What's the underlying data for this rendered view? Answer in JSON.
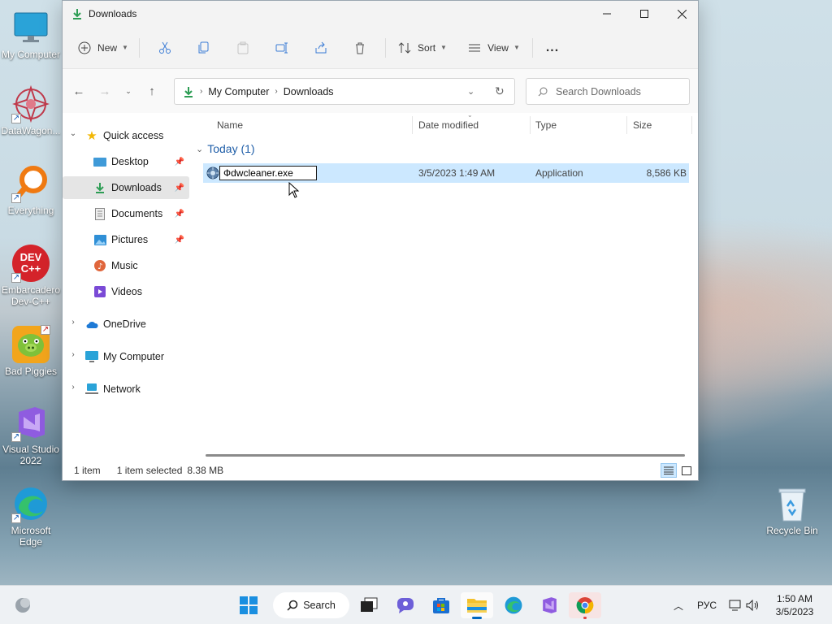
{
  "desktop": {
    "icons": [
      {
        "label": "My Computer"
      },
      {
        "label": "DataWagon..."
      },
      {
        "label": "Everything"
      },
      {
        "label": "Embarcadero Dev-C++"
      },
      {
        "label": "Bad Piggies"
      },
      {
        "label": "Visual Studio 2022"
      },
      {
        "label": "Microsoft Edge"
      },
      {
        "label": "Recycle Bin"
      }
    ],
    "devcpp_logo_text": "DEV C++"
  },
  "window": {
    "title": "Downloads",
    "toolbar": {
      "new_label": "New",
      "sort_label": "Sort",
      "view_label": "View",
      "more_label": "..."
    },
    "address": {
      "crumbs": [
        "My Computer",
        "Downloads"
      ]
    },
    "search": {
      "placeholder": "Search Downloads"
    },
    "nav": {
      "quick_access": "Quick access",
      "items": [
        {
          "label": "Desktop",
          "pinned": true
        },
        {
          "label": "Downloads",
          "pinned": true,
          "selected": true
        },
        {
          "label": "Documents",
          "pinned": true
        },
        {
          "label": "Pictures",
          "pinned": true
        },
        {
          "label": "Music",
          "pinned": false
        },
        {
          "label": "Videos",
          "pinned": false
        }
      ],
      "onedrive": "OneDrive",
      "my_computer": "My Computer",
      "network": "Network"
    },
    "columns": {
      "name": "Name",
      "date_modified": "Date modified",
      "type": "Type",
      "size": "Size"
    },
    "group": {
      "label": "Today (1)"
    },
    "files": [
      {
        "name": "Фdwcleaner.exe",
        "date_modified": "3/5/2023 1:49 AM",
        "type": "Application",
        "size": "8,586 KB",
        "selected": true,
        "renaming": true
      }
    ],
    "status": {
      "count": "1 item",
      "selection": "1 item selected",
      "selection_size": "8.38 MB"
    }
  },
  "taskbar": {
    "search_label": "Search",
    "language": "РУС",
    "time": "1:50 AM",
    "date": "3/5/2023"
  },
  "colors": {
    "accent": "#0067c0",
    "selection": "#cce8ff",
    "group_header": "#1f5ea8",
    "downloads_green": "#2e9d55"
  }
}
